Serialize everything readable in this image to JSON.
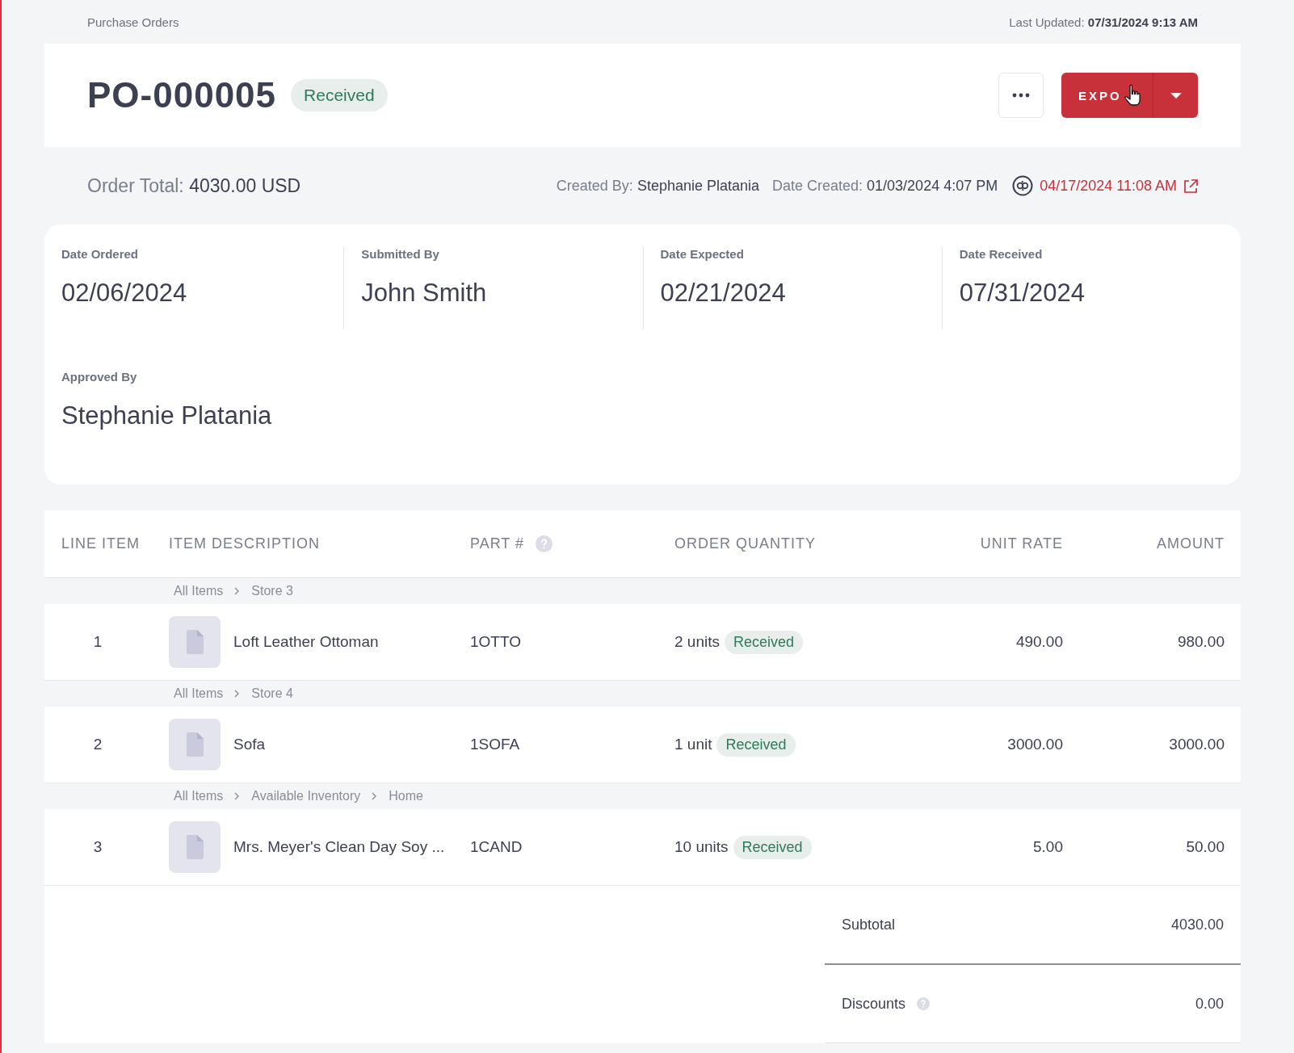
{
  "breadcrumb": "Purchase Orders",
  "last_updated": {
    "label": "Last Updated:",
    "value": "07/31/2024 9:13 AM"
  },
  "header": {
    "title": "PO-000005",
    "status": "Received",
    "export_button": "EXPO"
  },
  "summary": {
    "order_total_label": "Order Total:",
    "order_total": "4030.00 USD",
    "created_by_label": "Created By:",
    "created_by": "Stephanie Platania",
    "date_created_label": "Date Created:",
    "date_created": "01/03/2024 4:07 PM",
    "sync_time": "04/17/2024 11:08 AM"
  },
  "details": [
    {
      "label": "Date Ordered",
      "value": "02/06/2024"
    },
    {
      "label": "Submitted By",
      "value": "John Smith"
    },
    {
      "label": "Date Expected",
      "value": "02/21/2024"
    },
    {
      "label": "Date Received",
      "value": "07/31/2024"
    },
    {
      "label": "Approved By",
      "value": "Stephanie Platania"
    }
  ],
  "table": {
    "columns": [
      {
        "label": "LINE ITEM",
        "help": false
      },
      {
        "label": "ITEM DESCRIPTION",
        "help": false
      },
      {
        "label": "PART #",
        "help": true
      },
      {
        "label": "ORDER QUANTITY",
        "help": false
      },
      {
        "label": "UNIT RATE",
        "help": false
      },
      {
        "label": "AMOUNT",
        "help": false
      }
    ],
    "rows": [
      {
        "path": [
          "All Items",
          "Store 3"
        ],
        "line": "1",
        "description": "Loft Leather Ottoman",
        "part": "1OTTO",
        "quantity": "2 units",
        "status": "Received",
        "unit_rate": "490.00",
        "amount": "980.00"
      },
      {
        "path": [
          "All Items",
          "Store 4"
        ],
        "line": "2",
        "description": "Sofa",
        "part": "1SOFA",
        "quantity": "1 unit",
        "status": "Received",
        "unit_rate": "3000.00",
        "amount": "3000.00"
      },
      {
        "path": [
          "All Items",
          "Available Inventory",
          "Home"
        ],
        "line": "3",
        "description": "Mrs. Meyer's Clean Day Soy ...",
        "part": "1CAND",
        "quantity": "10 units",
        "status": "Received",
        "unit_rate": "5.00",
        "amount": "50.00"
      }
    ]
  },
  "totals": [
    {
      "label": "Subtotal",
      "value": "4030.00",
      "help": false
    },
    {
      "label": "Discounts",
      "value": "0.00",
      "help": true
    }
  ]
}
